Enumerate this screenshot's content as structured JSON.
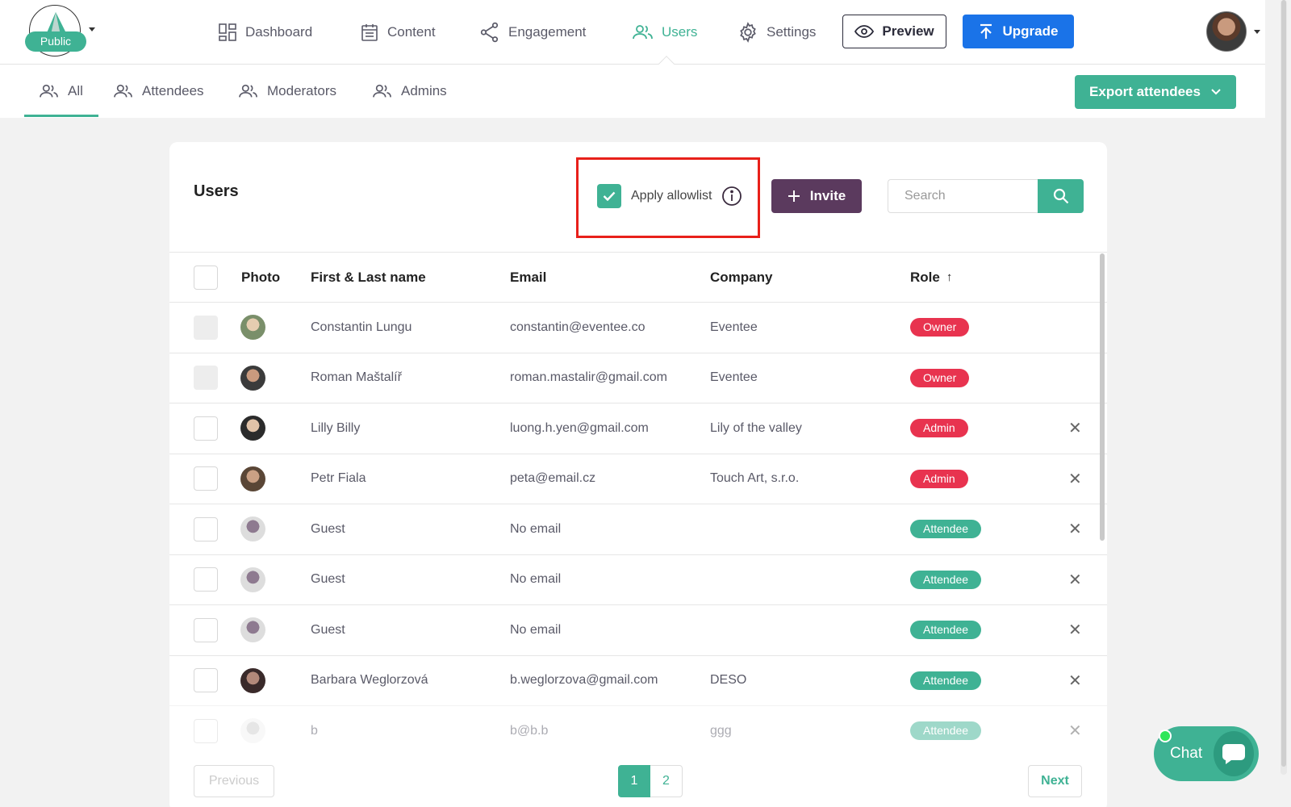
{
  "app": {
    "visibility_badge": "Public",
    "accent_color": "#3fb294",
    "danger_color": "#e8334f",
    "invite_color": "#5b3a5e",
    "upgrade_color": "#1a73e8"
  },
  "topnav": {
    "items": [
      {
        "label": "Dashboard",
        "icon": "dashboard-icon"
      },
      {
        "label": "Content",
        "icon": "calendar-icon"
      },
      {
        "label": "Engagement",
        "icon": "share-icon"
      },
      {
        "label": "Users",
        "icon": "users-icon",
        "active": true
      },
      {
        "label": "Settings",
        "icon": "gear-icon"
      }
    ],
    "preview_label": "Preview",
    "upgrade_label": "Upgrade"
  },
  "subnav": {
    "tabs": [
      {
        "label": "All",
        "active": true
      },
      {
        "label": "Attendees"
      },
      {
        "label": "Moderators"
      },
      {
        "label": "Admins"
      }
    ],
    "export_label": "Export attendees"
  },
  "users_card": {
    "title": "Users",
    "allowlist_label": "Apply allowlist",
    "allowlist_checked": true,
    "invite_label": "Invite",
    "search_placeholder": "Search",
    "columns": {
      "photo": "Photo",
      "name": "First & Last name",
      "email": "Email",
      "company": "Company",
      "role": "Role",
      "role_sort": "↑"
    },
    "rows": [
      {
        "name": "Constantin Lungu",
        "email": "constantin@eventee.co",
        "company": "Eventee",
        "role": "Owner",
        "role_type": "owner",
        "removable": false,
        "selectable": false
      },
      {
        "name": "Roman Maštalíř",
        "email": "roman.mastalir@gmail.com",
        "company": "Eventee",
        "role": "Owner",
        "role_type": "owner",
        "removable": false,
        "selectable": false
      },
      {
        "name": "Lilly Billy",
        "email": "luong.h.yen@gmail.com",
        "company": "Lily of the valley",
        "role": "Admin",
        "role_type": "admin",
        "removable": true,
        "selectable": true
      },
      {
        "name": "Petr Fiala",
        "email": "peta@email.cz",
        "company": "Touch Art, s.r.o.",
        "role": "Admin",
        "role_type": "admin",
        "removable": true,
        "selectable": true
      },
      {
        "name": "Guest",
        "email": "No email",
        "company": "",
        "role": "Attendee",
        "role_type": "attendee",
        "removable": true,
        "selectable": true
      },
      {
        "name": "Guest",
        "email": "No email",
        "company": "",
        "role": "Attendee",
        "role_type": "attendee",
        "removable": true,
        "selectable": true
      },
      {
        "name": "Guest",
        "email": "No email",
        "company": "",
        "role": "Attendee",
        "role_type": "attendee",
        "removable": true,
        "selectable": true
      },
      {
        "name": "Barbara Weglorzová",
        "email": "b.weglorzova@gmail.com",
        "company": "DESO",
        "role": "Attendee",
        "role_type": "attendee",
        "removable": true,
        "selectable": true
      },
      {
        "name": "b",
        "email": "b@b.b",
        "company": "ggg",
        "role": "Attendee",
        "role_type": "attendee",
        "removable": true,
        "selectable": true,
        "faded": true
      }
    ],
    "pagination": {
      "previous_label": "Previous",
      "next_label": "Next",
      "pages": [
        "1",
        "2"
      ],
      "current_page": "1"
    }
  },
  "chat": {
    "label": "Chat"
  }
}
